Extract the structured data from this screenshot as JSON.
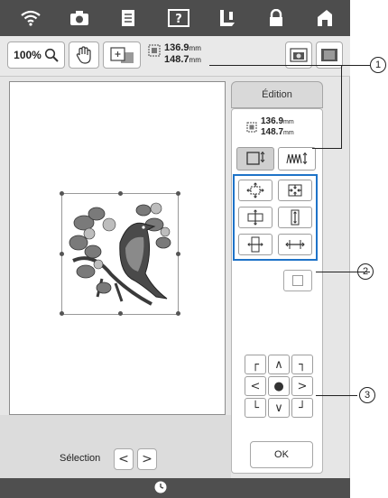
{
  "toolbar": {
    "zoom_label": "100%",
    "size_width": "136.9",
    "size_height": "148.7",
    "size_unit": "mm"
  },
  "panel": {
    "edition_tab": "Édition",
    "size_width": "136.9",
    "size_height": "148.7",
    "size_unit": "mm",
    "ok_label": "OK"
  },
  "bottom": {
    "selection_label": "Sélection"
  },
  "callouts": {
    "c1": "1",
    "c2": "2",
    "c3": "3"
  },
  "colors": {
    "highlight": "#1e73c8",
    "topbar": "#4d4d4d"
  }
}
